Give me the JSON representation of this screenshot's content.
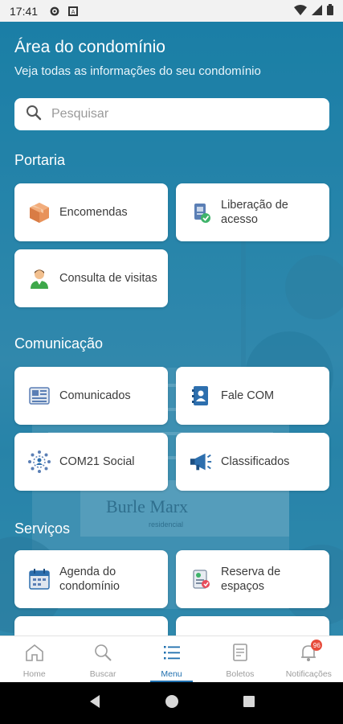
{
  "status": {
    "time": "17:41"
  },
  "header": {
    "title": "Área do condomínio",
    "subtitle": "Veja todas as informações do seu condomínio"
  },
  "search": {
    "placeholder": "Pesquisar"
  },
  "background": {
    "sign_text": "Burle Marx",
    "sign_subtext": "residencial"
  },
  "sections": {
    "portaria": "Portaria",
    "comunicacao": "Comunicação",
    "servicos": "Serviços"
  },
  "cards": {
    "encomendas": "Encomendas",
    "liberacao": "Liberação de acesso",
    "consulta": "Consulta de visitas",
    "comunicados": "Comunicados",
    "fale_com": "Fale COM",
    "com21_social": "COM21 Social",
    "classificados": "Classificados",
    "agenda": "Agenda do condomínio",
    "reserva": "Reserva de espaços"
  },
  "bottom_nav": {
    "home": "Home",
    "buscar": "Buscar",
    "menu": "Menu",
    "boletos": "Boletos",
    "notificacoes": "Notificações",
    "badge": "96"
  },
  "colors": {
    "accent": "#1f6fae",
    "header_bg": "#1a7fa6",
    "badge": "#e74c3c"
  }
}
